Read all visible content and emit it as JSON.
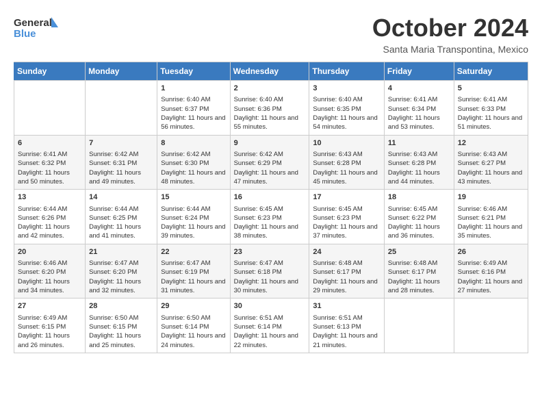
{
  "header": {
    "logo_line1": "General",
    "logo_line2": "Blue",
    "month": "October 2024",
    "location": "Santa Maria Transpontina, Mexico"
  },
  "weekdays": [
    "Sunday",
    "Monday",
    "Tuesday",
    "Wednesday",
    "Thursday",
    "Friday",
    "Saturday"
  ],
  "weeks": [
    [
      {
        "day": "",
        "info": ""
      },
      {
        "day": "",
        "info": ""
      },
      {
        "day": "1",
        "info": "Sunrise: 6:40 AM\nSunset: 6:37 PM\nDaylight: 11 hours and 56 minutes."
      },
      {
        "day": "2",
        "info": "Sunrise: 6:40 AM\nSunset: 6:36 PM\nDaylight: 11 hours and 55 minutes."
      },
      {
        "day": "3",
        "info": "Sunrise: 6:40 AM\nSunset: 6:35 PM\nDaylight: 11 hours and 54 minutes."
      },
      {
        "day": "4",
        "info": "Sunrise: 6:41 AM\nSunset: 6:34 PM\nDaylight: 11 hours and 53 minutes."
      },
      {
        "day": "5",
        "info": "Sunrise: 6:41 AM\nSunset: 6:33 PM\nDaylight: 11 hours and 51 minutes."
      }
    ],
    [
      {
        "day": "6",
        "info": "Sunrise: 6:41 AM\nSunset: 6:32 PM\nDaylight: 11 hours and 50 minutes."
      },
      {
        "day": "7",
        "info": "Sunrise: 6:42 AM\nSunset: 6:31 PM\nDaylight: 11 hours and 49 minutes."
      },
      {
        "day": "8",
        "info": "Sunrise: 6:42 AM\nSunset: 6:30 PM\nDaylight: 11 hours and 48 minutes."
      },
      {
        "day": "9",
        "info": "Sunrise: 6:42 AM\nSunset: 6:29 PM\nDaylight: 11 hours and 47 minutes."
      },
      {
        "day": "10",
        "info": "Sunrise: 6:43 AM\nSunset: 6:28 PM\nDaylight: 11 hours and 45 minutes."
      },
      {
        "day": "11",
        "info": "Sunrise: 6:43 AM\nSunset: 6:28 PM\nDaylight: 11 hours and 44 minutes."
      },
      {
        "day": "12",
        "info": "Sunrise: 6:43 AM\nSunset: 6:27 PM\nDaylight: 11 hours and 43 minutes."
      }
    ],
    [
      {
        "day": "13",
        "info": "Sunrise: 6:44 AM\nSunset: 6:26 PM\nDaylight: 11 hours and 42 minutes."
      },
      {
        "day": "14",
        "info": "Sunrise: 6:44 AM\nSunset: 6:25 PM\nDaylight: 11 hours and 41 minutes."
      },
      {
        "day": "15",
        "info": "Sunrise: 6:44 AM\nSunset: 6:24 PM\nDaylight: 11 hours and 39 minutes."
      },
      {
        "day": "16",
        "info": "Sunrise: 6:45 AM\nSunset: 6:23 PM\nDaylight: 11 hours and 38 minutes."
      },
      {
        "day": "17",
        "info": "Sunrise: 6:45 AM\nSunset: 6:23 PM\nDaylight: 11 hours and 37 minutes."
      },
      {
        "day": "18",
        "info": "Sunrise: 6:45 AM\nSunset: 6:22 PM\nDaylight: 11 hours and 36 minutes."
      },
      {
        "day": "19",
        "info": "Sunrise: 6:46 AM\nSunset: 6:21 PM\nDaylight: 11 hours and 35 minutes."
      }
    ],
    [
      {
        "day": "20",
        "info": "Sunrise: 6:46 AM\nSunset: 6:20 PM\nDaylight: 11 hours and 34 minutes."
      },
      {
        "day": "21",
        "info": "Sunrise: 6:47 AM\nSunset: 6:20 PM\nDaylight: 11 hours and 32 minutes."
      },
      {
        "day": "22",
        "info": "Sunrise: 6:47 AM\nSunset: 6:19 PM\nDaylight: 11 hours and 31 minutes."
      },
      {
        "day": "23",
        "info": "Sunrise: 6:47 AM\nSunset: 6:18 PM\nDaylight: 11 hours and 30 minutes."
      },
      {
        "day": "24",
        "info": "Sunrise: 6:48 AM\nSunset: 6:17 PM\nDaylight: 11 hours and 29 minutes."
      },
      {
        "day": "25",
        "info": "Sunrise: 6:48 AM\nSunset: 6:17 PM\nDaylight: 11 hours and 28 minutes."
      },
      {
        "day": "26",
        "info": "Sunrise: 6:49 AM\nSunset: 6:16 PM\nDaylight: 11 hours and 27 minutes."
      }
    ],
    [
      {
        "day": "27",
        "info": "Sunrise: 6:49 AM\nSunset: 6:15 PM\nDaylight: 11 hours and 26 minutes."
      },
      {
        "day": "28",
        "info": "Sunrise: 6:50 AM\nSunset: 6:15 PM\nDaylight: 11 hours and 25 minutes."
      },
      {
        "day": "29",
        "info": "Sunrise: 6:50 AM\nSunset: 6:14 PM\nDaylight: 11 hours and 24 minutes."
      },
      {
        "day": "30",
        "info": "Sunrise: 6:51 AM\nSunset: 6:14 PM\nDaylight: 11 hours and 22 minutes."
      },
      {
        "day": "31",
        "info": "Sunrise: 6:51 AM\nSunset: 6:13 PM\nDaylight: 11 hours and 21 minutes."
      },
      {
        "day": "",
        "info": ""
      },
      {
        "day": "",
        "info": ""
      }
    ]
  ]
}
